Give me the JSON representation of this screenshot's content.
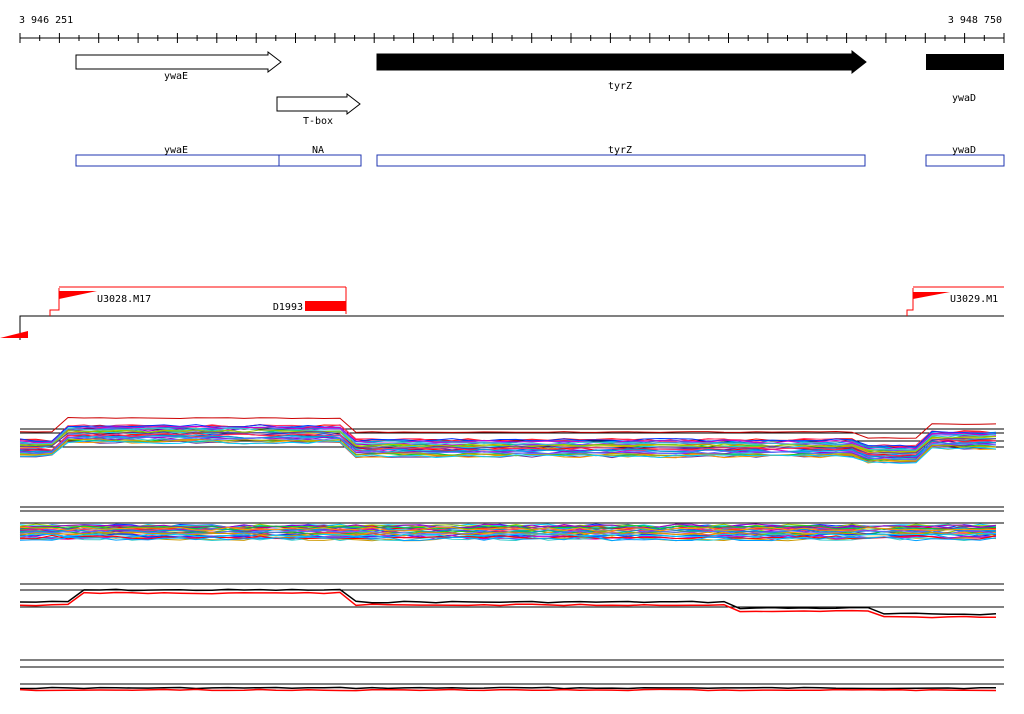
{
  "coordinates": {
    "start_label": "3 946 251",
    "end_label": "3 948 750",
    "start": 3946251,
    "end": 3948750
  },
  "colors": {
    "gene_outline": "#000000",
    "annotation_box": "#1f35b0",
    "feature_red": "#ff0000",
    "track_line": "#000000"
  },
  "genes": [
    {
      "name": "ywaE",
      "strand": "+",
      "filled": false
    },
    {
      "name": "T-box",
      "strand": "+",
      "filled": false
    },
    {
      "name": "tyrZ",
      "strand": "+",
      "filled": true
    },
    {
      "name": "ywaD",
      "strand": "+",
      "filled": true
    }
  ],
  "annotations": [
    {
      "label": "ywaE"
    },
    {
      "label": "NA"
    },
    {
      "label": "tyrZ"
    },
    {
      "label": "ywaD"
    }
  ],
  "segments": [
    {
      "label": "U3028.M17"
    },
    {
      "label": "D1993"
    },
    {
      "label": "U3029.M1"
    }
  ]
}
